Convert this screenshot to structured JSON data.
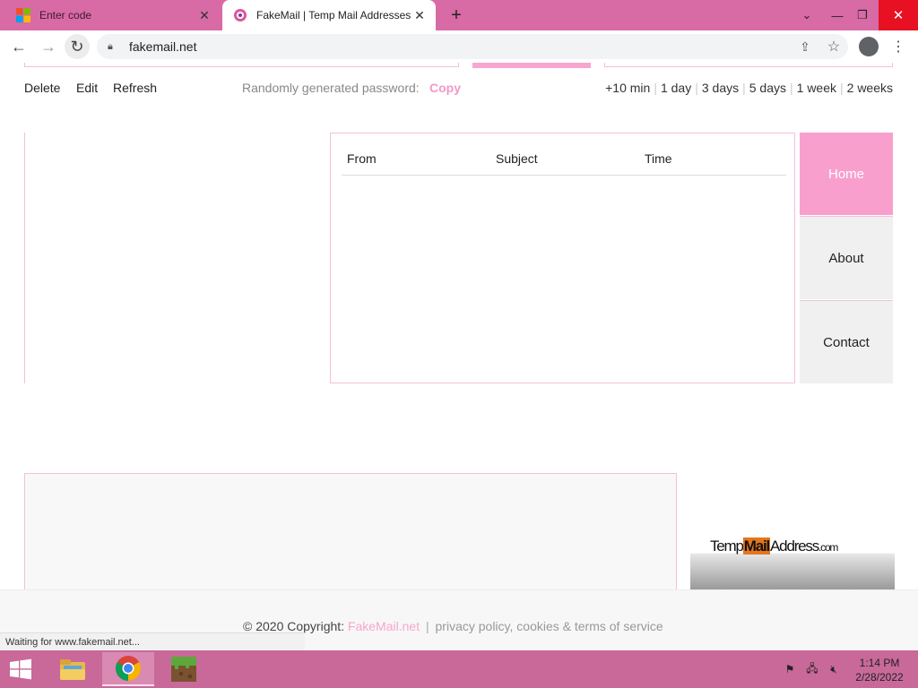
{
  "browser": {
    "tabs": [
      {
        "title": "Enter code",
        "active": false,
        "favicon": "microsoft-icon"
      },
      {
        "title": "FakeMail | Temp Mail Addresses",
        "active": true,
        "favicon": "fakemail-icon"
      }
    ],
    "url": "fakemail.net",
    "status": "Waiting for www.fakemail.net..."
  },
  "actions": {
    "delete": "Delete",
    "edit": "Edit",
    "refresh": "Refresh",
    "password_label": "Randomly generated password:",
    "password_copy": "Copy"
  },
  "extend_options": [
    "+10 min",
    "1 day",
    "3 days",
    "5 days",
    "1 week",
    "2 weeks"
  ],
  "inbox": {
    "columns": {
      "from": "From",
      "subject": "Subject",
      "time": "Time"
    }
  },
  "nav": {
    "home": "Home",
    "about": "About",
    "contact": "Contact"
  },
  "ad": {
    "logo_prefix": "Temp",
    "logo_highlight": "Mail",
    "logo_suffix": "Address",
    "logo_tld": ".com"
  },
  "footer": {
    "copyright": "© 2020 Copyright: ",
    "brand": "FakeMail.net",
    "separator": "|",
    "links": "privacy policy, cookies & terms of service"
  },
  "taskbar": {
    "time": "1:14 PM",
    "date": "2/28/2022"
  },
  "colors": {
    "tabbar": "#d86aa6",
    "accent_pink": "#f99fcd",
    "taskbar": "#c8699a",
    "close_red": "#e81123"
  }
}
